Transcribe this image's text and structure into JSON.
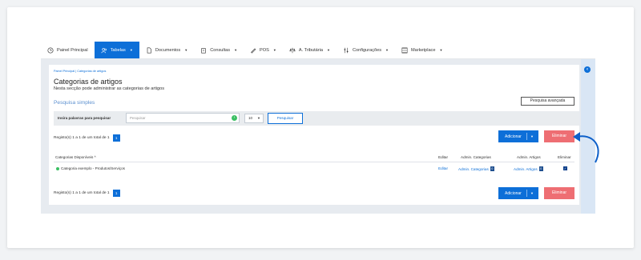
{
  "nav": {
    "items": [
      {
        "label": "Painel Principal",
        "icon": "clock-icon",
        "caret": false,
        "active": false
      },
      {
        "label": "Tabelas",
        "icon": "users-icon",
        "caret": true,
        "active": true
      },
      {
        "label": "Documentos",
        "icon": "document-icon",
        "caret": true,
        "active": false
      },
      {
        "label": "Consultas",
        "icon": "building-icon",
        "caret": true,
        "active": false
      },
      {
        "label": "POS",
        "icon": "pen-icon",
        "caret": true,
        "active": false
      },
      {
        "label": "A. Tributária",
        "icon": "scale-icon",
        "caret": true,
        "active": false
      },
      {
        "label": "Configurações",
        "icon": "sliders-icon",
        "caret": true,
        "active": false
      },
      {
        "label": "Marketplace",
        "icon": "list-icon",
        "caret": true,
        "active": false
      }
    ]
  },
  "header": {
    "breadcrumb": "Painel Principal  |  Categorias de artigos",
    "title": "Categorias de artigos",
    "subtitle": "Nesta secção pode administrar as categorias de artigos",
    "advanced_search": "Pesquisa avançada",
    "simple_search": "Pesquisa simples"
  },
  "search": {
    "label": "Insira palavras para pesquisar",
    "placeholder": "Pesquisar",
    "per_page": "10",
    "button": "Pesquisar"
  },
  "records": {
    "text": "Registo(s) 1 a 1 de um total de 1",
    "page": "1"
  },
  "actions": {
    "add": "Adicionar",
    "delete": "Eliminar"
  },
  "table": {
    "headers": {
      "category": "Categorias Disponíveis",
      "sort_icon": "^",
      "edit": "Editar",
      "admin_categories": "Admin. Categorias",
      "admin_articles": "Admin. Artigos",
      "delete": "Eliminar"
    },
    "rows": [
      {
        "category": "Categoria exemplo - Produtos/Serviços",
        "edit": "Editar",
        "admin_categories": "Admin. Categorias",
        "admin_categories_count": "0",
        "admin_articles": "Admin. Artigos",
        "admin_articles_count": "0",
        "checked": true
      }
    ]
  },
  "colors": {
    "accent": "#0d6fd8",
    "danger": "#ee6e73",
    "success": "#3bbf63"
  }
}
